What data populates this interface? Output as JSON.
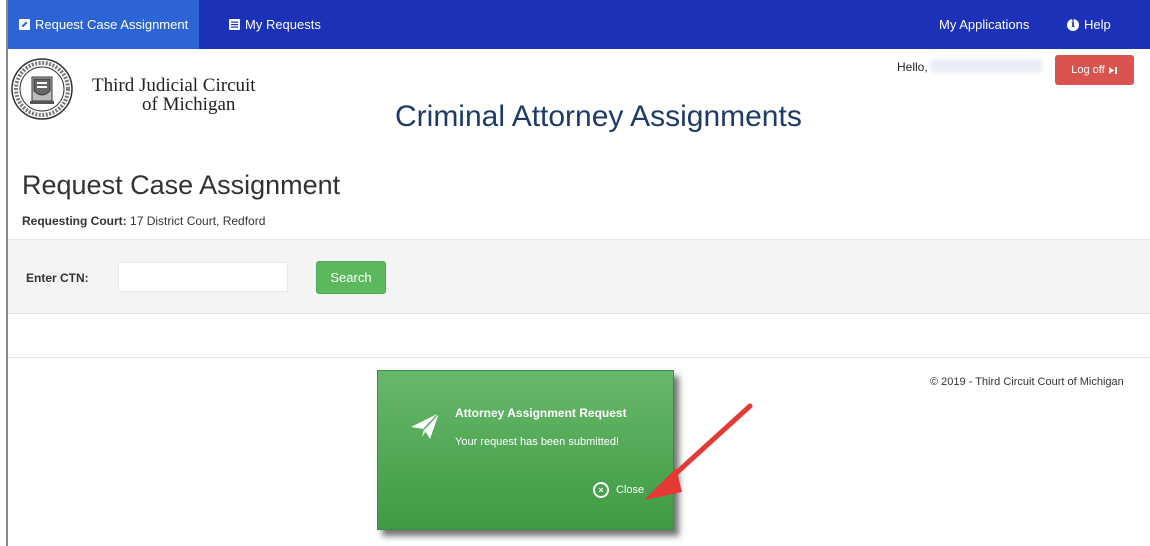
{
  "nav": {
    "left": [
      {
        "label": "Request Case Assignment",
        "icon": "edit-icon",
        "active": true
      },
      {
        "label": "My Requests",
        "icon": "list-icon",
        "active": false
      }
    ],
    "right": [
      {
        "label": "My Applications"
      },
      {
        "label": "Help",
        "icon": "info-icon"
      }
    ]
  },
  "header": {
    "org_line1": "Third Judicial Circuit",
    "org_line2": "of Michigan",
    "site_title": "Criminal Attorney Assignments",
    "hello": "Hello,",
    "logoff_label": "Log off"
  },
  "page": {
    "title": "Request Case Assignment",
    "court_label": "Requesting Court:",
    "court_value": "17 District Court, Redford"
  },
  "search": {
    "ctn_label": "Enter CTN:",
    "ctn_value": "",
    "button_label": "Search"
  },
  "footer": {
    "copyright": "© 2019 - Third Circuit Court of Michigan"
  },
  "toast": {
    "title": "Attorney Assignment Request",
    "message": "Your request has been submitted!",
    "close_label": "Close"
  },
  "colors": {
    "nav_bg": "#1b31b8",
    "nav_active": "#2c64d6",
    "toast_green": "#4caf50",
    "logoff_red": "#d9534f",
    "arrow_red": "#e53935"
  }
}
